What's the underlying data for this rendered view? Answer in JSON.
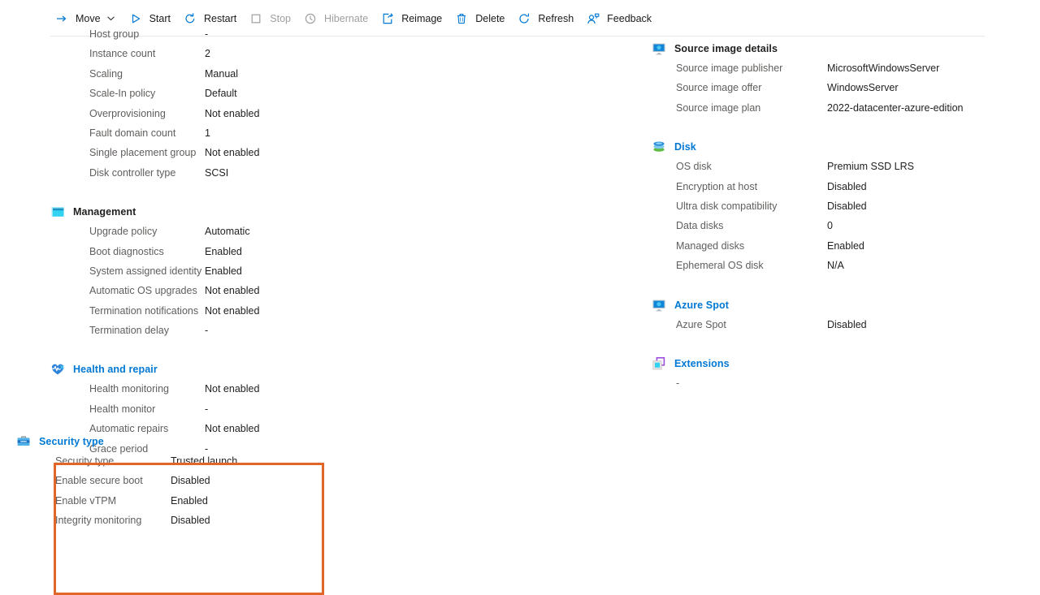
{
  "commandbar": {
    "items": [
      {
        "label": "Move",
        "icon": "move-arrow-icon",
        "disabled": false,
        "has_chevron": true
      },
      {
        "label": "Start",
        "icon": "play-icon",
        "disabled": false,
        "has_chevron": false
      },
      {
        "label": "Restart",
        "icon": "restart-icon",
        "disabled": false,
        "has_chevron": false
      },
      {
        "label": "Stop",
        "icon": "stop-square-icon",
        "disabled": true,
        "has_chevron": false
      },
      {
        "label": "Hibernate",
        "icon": "clock-icon",
        "disabled": true,
        "has_chevron": false
      },
      {
        "label": "Reimage",
        "icon": "reimage-icon",
        "disabled": false,
        "has_chevron": false
      },
      {
        "label": "Delete",
        "icon": "trash-icon",
        "disabled": false,
        "has_chevron": false
      },
      {
        "label": "Refresh",
        "icon": "refresh-icon",
        "disabled": false,
        "has_chevron": false
      },
      {
        "label": "Feedback",
        "icon": "feedback-person-icon",
        "disabled": false,
        "has_chevron": false
      }
    ]
  },
  "colors": {
    "accent_blue": "#0078d4",
    "highlight_orange": "#e2652a",
    "label_gray": "#605e5c",
    "value_black": "#201f1e",
    "disabled_gray": "#a19f9d"
  },
  "left_column": {
    "top_partial_rows": [
      {
        "label": "Host group",
        "value": "-"
      },
      {
        "label": "Instance count",
        "value": "2"
      },
      {
        "label": "Scaling",
        "value": "Manual"
      },
      {
        "label": "Scale-In policy",
        "value": "Default"
      },
      {
        "label": "Overprovisioning",
        "value": "Not enabled"
      },
      {
        "label": "Fault domain count",
        "value": "1"
      },
      {
        "label": "Single placement group",
        "value": "Not enabled"
      },
      {
        "label": "Disk controller type",
        "value": "SCSI"
      }
    ],
    "sections": [
      {
        "title": "Management",
        "icon": "management-window-icon",
        "title_style": "plain",
        "rows": [
          {
            "label": "Upgrade policy",
            "value": "Automatic"
          },
          {
            "label": "Boot diagnostics",
            "value": "Enabled"
          },
          {
            "label": "System assigned identity",
            "value": "Enabled"
          },
          {
            "label": "Automatic OS upgrades",
            "value": "Not enabled"
          },
          {
            "label": "Termination notifications",
            "value": "Not enabled"
          },
          {
            "label": "Termination delay",
            "value": "-"
          }
        ]
      },
      {
        "title": "Health and repair",
        "icon": "heart-pulse-icon",
        "title_style": "link",
        "rows": [
          {
            "label": "Health monitoring",
            "value": "Not enabled"
          },
          {
            "label": "Health monitor",
            "value": "-"
          },
          {
            "label": "Automatic repairs",
            "value": "Not enabled"
          },
          {
            "label": "Grace period",
            "value": "-"
          }
        ]
      }
    ],
    "security_section": {
      "title": "Security type",
      "icon": "toolbox-icon",
      "title_style": "link",
      "highlighted": true,
      "rows": [
        {
          "label": "Security type",
          "value": "Trusted launch"
        },
        {
          "label": "Enable secure boot",
          "value": "Disabled"
        },
        {
          "label": "Enable vTPM",
          "value": "Enabled"
        },
        {
          "label": "Integrity monitoring",
          "value": "Disabled"
        }
      ]
    }
  },
  "right_column": {
    "sections": [
      {
        "title": "Source image details",
        "icon": "monitor-icon",
        "title_style": "plain",
        "rows": [
          {
            "label": "Source image publisher",
            "value": "MicrosoftWindowsServer"
          },
          {
            "label": "Source image offer",
            "value": "WindowsServer"
          },
          {
            "label": "Source image plan",
            "value": "2022-datacenter-azure-edition"
          }
        ]
      },
      {
        "title": "Disk",
        "icon": "disk-stack-icon",
        "title_style": "link",
        "rows": [
          {
            "label": "OS disk",
            "value": "Premium SSD LRS"
          },
          {
            "label": "Encryption at host",
            "value": "Disabled"
          },
          {
            "label": "Ultra disk compatibility",
            "value": "Disabled"
          },
          {
            "label": "Data disks",
            "value": "0"
          },
          {
            "label": "Managed disks",
            "value": "Enabled"
          },
          {
            "label": "Ephemeral OS disk",
            "value": "N/A"
          }
        ]
      },
      {
        "title": "Azure Spot",
        "icon": "monitor-icon",
        "title_style": "link",
        "rows": [
          {
            "label": "Azure Spot",
            "value": "Disabled"
          }
        ]
      },
      {
        "title": "Extensions",
        "icon": "extensions-icon",
        "title_style": "link",
        "rows": [
          {
            "label": "-",
            "value": ""
          }
        ]
      }
    ]
  }
}
